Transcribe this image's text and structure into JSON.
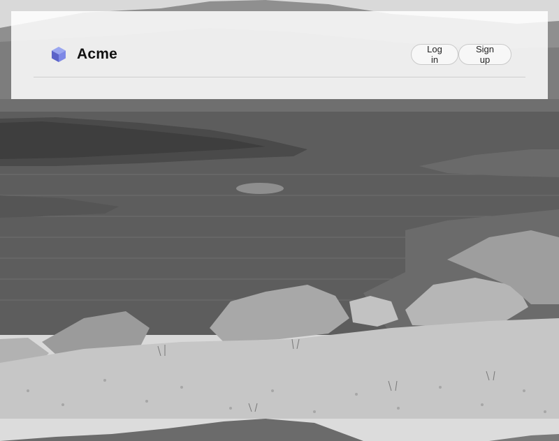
{
  "header": {
    "brand_name": "Acme",
    "brand_icon": "cube-icon",
    "login_label": "Log in",
    "signup_label": "Sign up"
  },
  "background": {
    "image_name": "lake-landscape-photo",
    "tone": "grayscale"
  },
  "colors": {
    "cube_top": "#9aa6f0",
    "cube_left": "#5b63c8",
    "cube_right": "#7d88e6"
  }
}
